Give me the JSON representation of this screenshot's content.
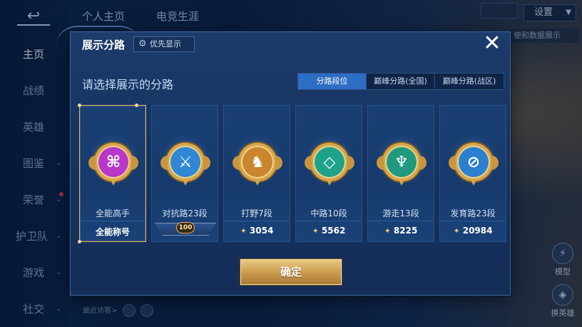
{
  "nav": {
    "items": [
      {
        "label": "主页",
        "active": true,
        "chevron": false
      },
      {
        "label": "战绩",
        "active": false,
        "chevron": false
      },
      {
        "label": "英雄",
        "active": false,
        "chevron": false
      },
      {
        "label": "图鉴",
        "active": false,
        "chevron": true
      },
      {
        "label": "荣誉",
        "active": false,
        "chevron": true,
        "dot": true
      },
      {
        "label": "护卫队",
        "active": false,
        "chevron": true
      },
      {
        "label": "游戏",
        "active": false,
        "chevron": true
      },
      {
        "label": "社交",
        "active": false,
        "chevron": true
      }
    ]
  },
  "top_tabs": [
    "个人主页",
    "电竞生涯"
  ],
  "settings": {
    "label": "设置"
  },
  "right_strip": {
    "text": "使和数据展示"
  },
  "visitors": {
    "label": "最近访客>"
  },
  "hero_buttons": [
    {
      "label": "模型"
    },
    {
      "label": "换英雄"
    }
  ],
  "modal": {
    "title": "展示分路",
    "priority_label": "优先显示",
    "subtitle": "请选择展示的分路",
    "segments": [
      {
        "label": "分路段位",
        "active": true
      },
      {
        "label": "巅峰分路(全国)",
        "active": false
      },
      {
        "label": "巅峰分路(战区)",
        "active": false
      }
    ],
    "cards": [
      {
        "label": "全能高手",
        "foot": "全能称号",
        "selected": true,
        "badge_color": "#b836c9",
        "glyph": "⌘",
        "foot_type": "title"
      },
      {
        "label": "对抗路23段",
        "foot": "100",
        "selected": false,
        "badge_color": "#2f87d6",
        "glyph": "⚔",
        "foot_type": "peak"
      },
      {
        "label": "打野7段",
        "foot": "3054",
        "selected": false,
        "badge_color": "#c9862e",
        "glyph": "♞",
        "foot_type": "score"
      },
      {
        "label": "中路10段",
        "foot": "5562",
        "selected": false,
        "badge_color": "#1fa28a",
        "glyph": "◇",
        "foot_type": "score"
      },
      {
        "label": "游走13段",
        "foot": "8225",
        "selected": false,
        "badge_color": "#1f9a7e",
        "glyph": "♆",
        "foot_type": "score"
      },
      {
        "label": "发育路23段",
        "foot": "20984",
        "selected": false,
        "badge_color": "#2b7fd0",
        "glyph": "⊘",
        "foot_type": "score"
      }
    ],
    "confirm_label": "确定"
  }
}
